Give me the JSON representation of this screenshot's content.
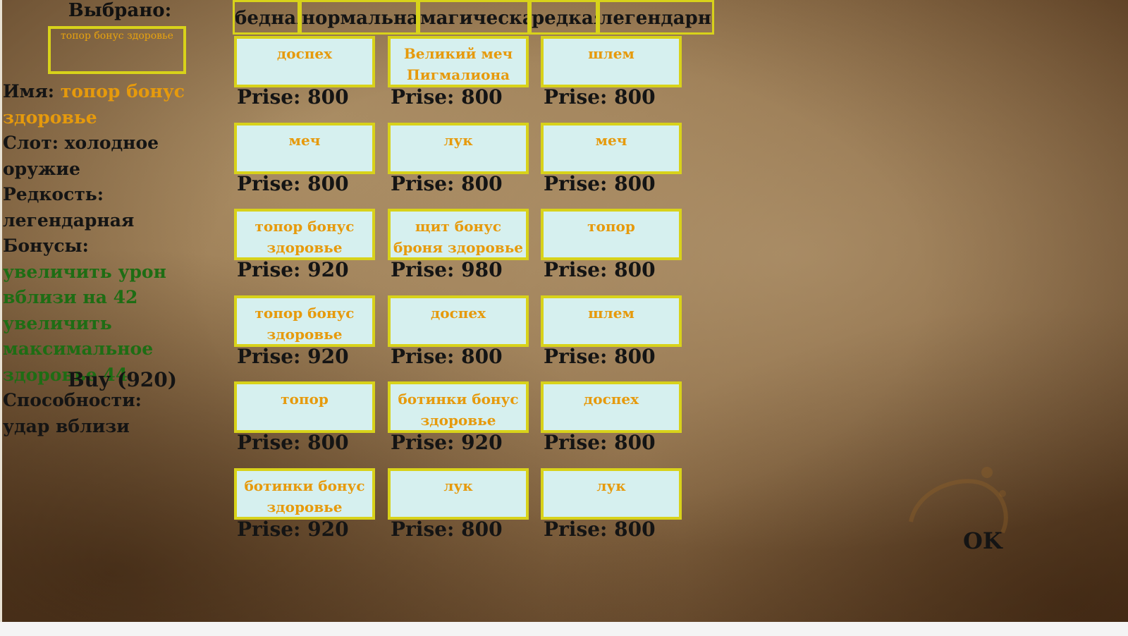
{
  "selected": {
    "title": "Выбрано:",
    "item": "топор бонус здоровье"
  },
  "info": {
    "name_label": "Имя:",
    "name_value": "топор бонус здоровье",
    "slot": "Слот: холодное оружие",
    "rarity": "Редкость: легендарная",
    "bonuses_label": "Бонусы:",
    "bonus_1": "увеличить урон вблизи на 42",
    "bonus_2": "увеличить максимальное здоровье 44",
    "abilities_label": "Способности:",
    "ability_1": "удар вблизи"
  },
  "buy_label": "Buy (920)",
  "tabs": [
    "бедная",
    "нормальная",
    "магическая",
    "редкая",
    "легендарная"
  ],
  "price_prefix": "Prise:",
  "items": [
    {
      "name": "доспех",
      "price": "Prise: 800"
    },
    {
      "name": "Великий меч Пигмалиона",
      "price": "Prise: 800"
    },
    {
      "name": "шлем",
      "price": "Prise: 800"
    },
    {
      "name": "меч",
      "price": "Prise: 800"
    },
    {
      "name": "лук",
      "price": "Prise: 800"
    },
    {
      "name": "меч",
      "price": "Prise: 800"
    },
    {
      "name": "топор бонус здоровье",
      "price": "Prise: 920"
    },
    {
      "name": "щит бонус броня здоровье",
      "price": "Prise: 980"
    },
    {
      "name": "топор",
      "price": "Prise: 800"
    },
    {
      "name": "топор бонус здоровье",
      "price": "Prise: 920"
    },
    {
      "name": "доспех",
      "price": "Prise: 800"
    },
    {
      "name": "шлем",
      "price": "Prise: 800"
    },
    {
      "name": "топор",
      "price": "Prise: 800"
    },
    {
      "name": "ботинки бонус здоровье",
      "price": "Prise: 920"
    },
    {
      "name": "доспех",
      "price": "Prise: 800"
    },
    {
      "name": "ботинки бонус здоровье",
      "price": "Prise: 920"
    },
    {
      "name": "лук",
      "price": "Prise: 800"
    },
    {
      "name": "лук",
      "price": "Prise: 800"
    }
  ],
  "ok_label": "OK",
  "colors": {
    "border": "#d8d21a",
    "card_bg": "#d6f0ef",
    "item_text": "#e69a0c",
    "bonus_text": "#1e6d14"
  }
}
